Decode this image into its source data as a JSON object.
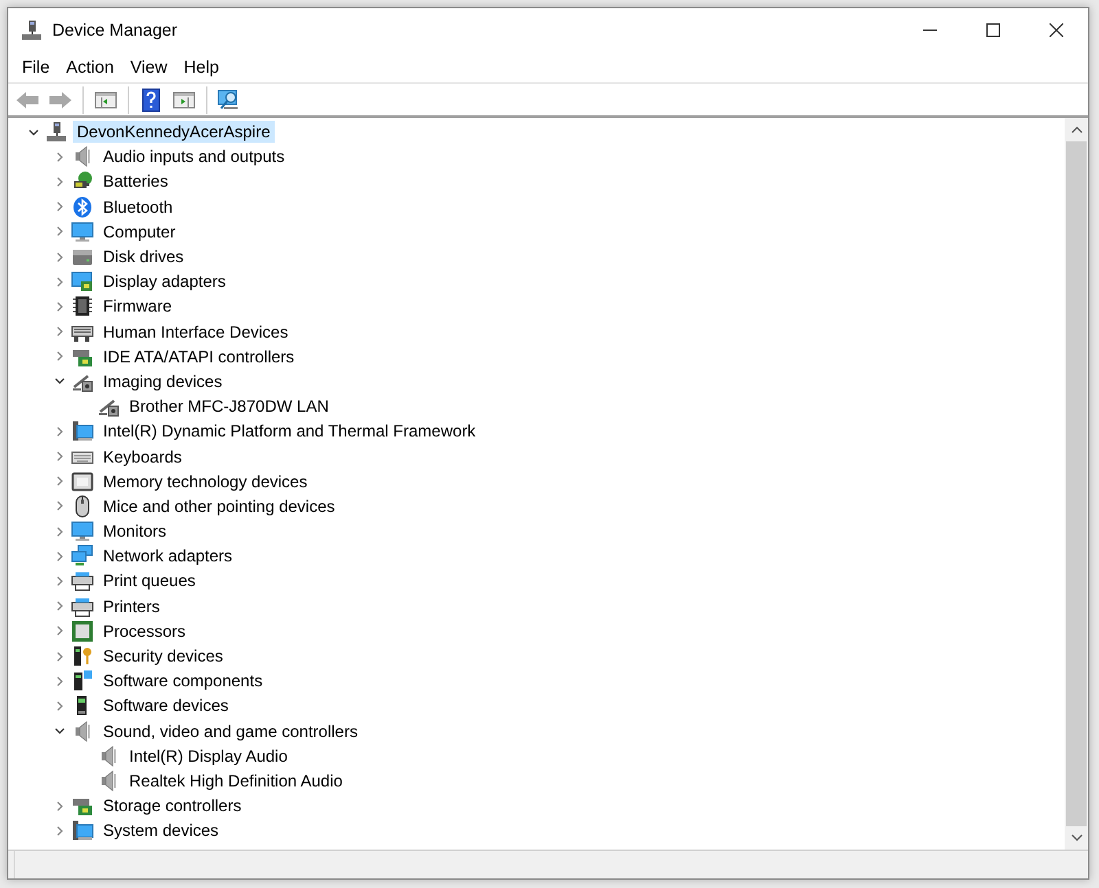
{
  "window": {
    "title": "Device Manager"
  },
  "menu": [
    "File",
    "Action",
    "View",
    "Help"
  ],
  "toolbar": [
    {
      "kind": "back",
      "disabled": true
    },
    {
      "kind": "forward",
      "disabled": true
    },
    {
      "kind": "separator"
    },
    {
      "kind": "console-tree",
      "disabled": false
    },
    {
      "kind": "separator"
    },
    {
      "kind": "help",
      "disabled": false
    },
    {
      "kind": "action-pane",
      "disabled": false
    },
    {
      "kind": "separator"
    },
    {
      "kind": "scan",
      "disabled": false
    }
  ],
  "tree": {
    "label": "DevonKennedyAcerAspire",
    "kind": "computer-tower",
    "expanded": true,
    "selected": true,
    "children": [
      {
        "label": "Audio inputs and outputs",
        "kind": "speaker",
        "expanded": false,
        "selected": false
      },
      {
        "label": "Batteries",
        "kind": "battery",
        "expanded": false,
        "selected": false
      },
      {
        "label": "Bluetooth",
        "kind": "bluetooth",
        "expanded": false,
        "selected": false
      },
      {
        "label": "Computer",
        "kind": "monitor",
        "expanded": false,
        "selected": false
      },
      {
        "label": "Disk drives",
        "kind": "drive",
        "expanded": false,
        "selected": false
      },
      {
        "label": "Display adapters",
        "kind": "display-adapter",
        "expanded": false,
        "selected": false
      },
      {
        "label": "Firmware",
        "kind": "firmware",
        "expanded": false,
        "selected": false
      },
      {
        "label": "Human Interface Devices",
        "kind": "hid",
        "expanded": false,
        "selected": false
      },
      {
        "label": "IDE ATA/ATAPI controllers",
        "kind": "board",
        "expanded": false,
        "selected": false
      },
      {
        "label": "Imaging devices",
        "kind": "scanner",
        "expanded": true,
        "selected": false,
        "children": [
          {
            "label": "Brother MFC-J870DW LAN",
            "kind": "scanner",
            "selected": false
          }
        ]
      },
      {
        "label": "Intel(R) Dynamic Platform and Thermal Framework",
        "kind": "system",
        "expanded": false,
        "selected": false
      },
      {
        "label": "Keyboards",
        "kind": "keyboard",
        "expanded": false,
        "selected": false
      },
      {
        "label": "Memory technology devices",
        "kind": "memory",
        "expanded": false,
        "selected": false
      },
      {
        "label": "Mice and other pointing devices",
        "kind": "mouse",
        "expanded": false,
        "selected": false
      },
      {
        "label": "Monitors",
        "kind": "monitor",
        "expanded": false,
        "selected": false
      },
      {
        "label": "Network adapters",
        "kind": "network",
        "expanded": false,
        "selected": false
      },
      {
        "label": "Print queues",
        "kind": "printer",
        "expanded": false,
        "selected": false
      },
      {
        "label": "Printers",
        "kind": "printer",
        "expanded": false,
        "selected": false
      },
      {
        "label": "Processors",
        "kind": "processor",
        "expanded": false,
        "selected": false
      },
      {
        "label": "Security devices",
        "kind": "security",
        "expanded": false,
        "selected": false
      },
      {
        "label": "Software components",
        "kind": "software-component",
        "expanded": false,
        "selected": false
      },
      {
        "label": "Software devices",
        "kind": "software-device",
        "expanded": false,
        "selected": false
      },
      {
        "label": "Sound, video and game controllers",
        "kind": "speaker",
        "expanded": true,
        "selected": false,
        "children": [
          {
            "label": "Intel(R) Display Audio",
            "kind": "speaker",
            "selected": false
          },
          {
            "label": "Realtek High Definition Audio",
            "kind": "speaker",
            "selected": false
          }
        ]
      },
      {
        "label": "Storage controllers",
        "kind": "board",
        "expanded": false,
        "selected": false
      },
      {
        "label": "System devices",
        "kind": "system",
        "expanded": false,
        "selected": false
      }
    ]
  }
}
